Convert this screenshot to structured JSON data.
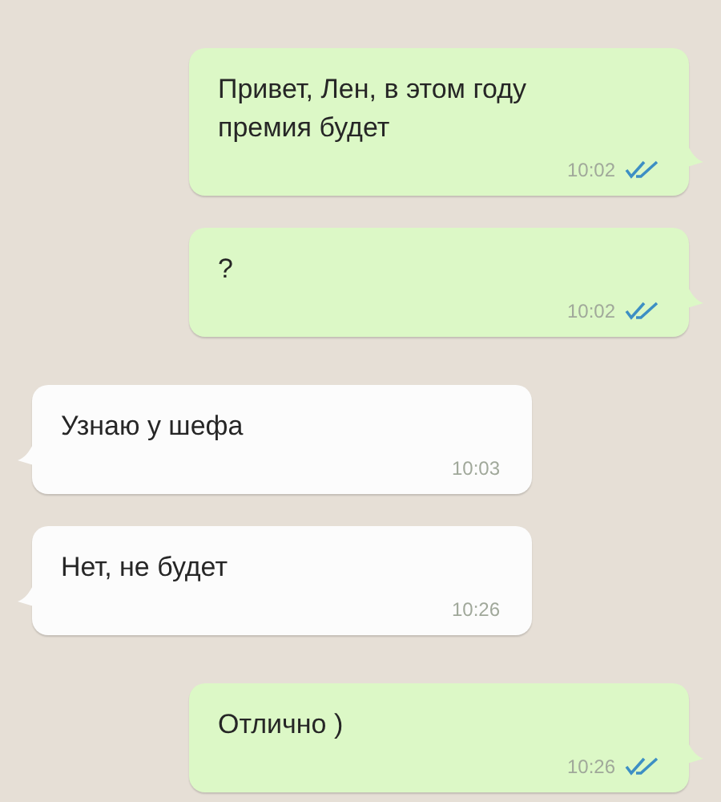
{
  "messages": [
    {
      "kind": "outgoing",
      "text": "Привет, Лен, в этом году премия будет",
      "time": "10:02",
      "read": true
    },
    {
      "kind": "outgoing",
      "text": "?",
      "time": "10:02",
      "read": true
    },
    {
      "kind": "incoming",
      "text": "Узнаю у шефа",
      "time": "10:03"
    },
    {
      "kind": "incoming",
      "text": "Нет, не будет",
      "time": "10:26"
    },
    {
      "kind": "outgoing",
      "text": "Отлично )",
      "time": "10:26",
      "read": true
    }
  ]
}
